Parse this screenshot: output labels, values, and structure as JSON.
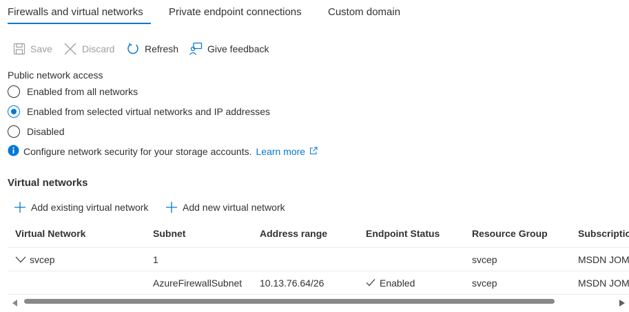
{
  "tabs": [
    {
      "label": "Firewalls and virtual networks",
      "active": true
    },
    {
      "label": "Private endpoint connections",
      "active": false
    },
    {
      "label": "Custom domain",
      "active": false
    }
  ],
  "toolbar": {
    "save_label": "Save",
    "discard_label": "Discard",
    "refresh_label": "Refresh",
    "feedback_label": "Give feedback"
  },
  "public_access": {
    "label": "Public network access",
    "options": [
      {
        "label": "Enabled from all networks",
        "checked": false
      },
      {
        "label": "Enabled from selected virtual networks and IP addresses",
        "checked": true
      },
      {
        "label": "Disabled",
        "checked": false
      }
    ]
  },
  "info": {
    "text": "Configure network security for your storage accounts.",
    "link": "Learn more"
  },
  "virtual_networks": {
    "title": "Virtual networks",
    "add_existing_label": "Add existing virtual network",
    "add_new_label": "Add new virtual network",
    "columns": [
      "Virtual Network",
      "Subnet",
      "Address range",
      "Endpoint Status",
      "Resource Group",
      "Subscription"
    ],
    "rows": [
      {
        "network": "svcep",
        "subnet": "1",
        "address": "",
        "status": "",
        "group": "svcep",
        "subscription": "MSDN JOM"
      },
      {
        "network": "",
        "subnet": "AzureFirewallSubnet",
        "address": "10.13.76.64/26",
        "status": "Enabled",
        "group": "svcep",
        "subscription": "MSDN JOM"
      }
    ]
  },
  "colors": {
    "accent": "#0078d4",
    "text": "#323130",
    "disabled": "#a19f9d"
  }
}
